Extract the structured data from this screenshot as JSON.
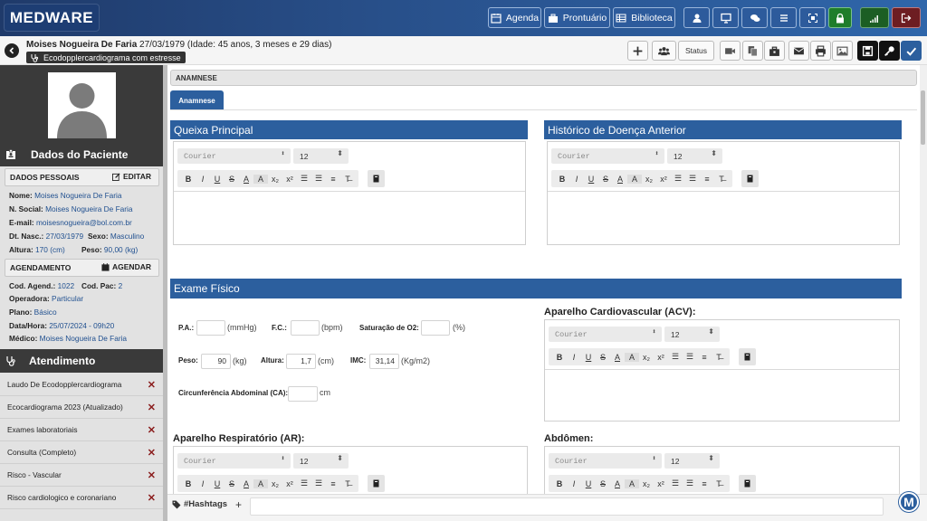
{
  "app": {
    "logo": "MEDWARE"
  },
  "topnav": {
    "agenda": "Agenda",
    "prontuario": "Prontuário",
    "biblioteca": "Biblioteca"
  },
  "patient": {
    "name": "Moises Nogueira De Faria",
    "dob_age": "27/03/1979 (Idade: 45 anos, 3 meses e 29 dias)",
    "exam": "Ecodopplercardiograma com estresse"
  },
  "actions": {
    "status": "Status"
  },
  "sidebar": {
    "title": "Dados do Paciente",
    "personal_header": "DADOS PESSOAIS",
    "edit": "EDITAR",
    "fields": {
      "nome_l": "Nome:",
      "nome": "Moises Nogueira De Faria",
      "nsocial_l": "N. Social:",
      "nsocial": "Moises Nogueira De Faria",
      "email_l": "E-mail:",
      "email": "moisesnogueira@bol.com.br",
      "dtnasc_l": "Dt. Nasc.:",
      "dtnasc": "27/03/1979",
      "sexo_l": "Sexo:",
      "sexo": "Masculino",
      "altura_l": "Altura:",
      "altura": "170 (cm)",
      "peso_l": "Peso:",
      "peso": "90,00 (kg)"
    },
    "sched_header": "AGENDAMENTO",
    "schedule": "AGENDAR",
    "sched": {
      "cod_l": "Cod. Agend.:",
      "cod": "1022",
      "codpac_l": "Cod. Pac:",
      "codpac": "2",
      "oper_l": "Operadora:",
      "oper": "Particular",
      "plano_l": "Plano:",
      "plano": "Básico",
      "data_l": "Data/Hora:",
      "data": "25/07/2024 - 09h20",
      "medico_l": "Médico:",
      "medico": "Moises Nogueira De Faria"
    },
    "atendimento_title": "Atendimento",
    "atendimentos": [
      "Laudo De Ecodopplercardiograma",
      "Ecocardiograma 2023 (Atualizado)",
      "Exames laboratoriais",
      "Consulta (Completo)",
      "Risco - Vascular",
      "Risco cardiologico e coronariano"
    ]
  },
  "main": {
    "anamnese_header": "ANAMNESE",
    "tab": "Anamnese",
    "queixa": "Queixa Principal",
    "historico": "Histórico de Doença Anterior",
    "exame": "Exame Físico",
    "acv": "Aparelho Cardiovascular (ACV):",
    "ar": "Aparelho Respiratório (AR):",
    "abdomen": "Abdômen:",
    "editor": {
      "font": "Courier",
      "size": "12"
    },
    "vitals": {
      "pa_l": "P.A.:",
      "pa_u": "(mmHg)",
      "fc_l": "F.C.:",
      "fc_u": "(bpm)",
      "sat_l": "Saturação de O2:",
      "sat_u": "(%)",
      "peso_l": "Peso:",
      "peso": "90",
      "peso_u": "(kg)",
      "alt_l": "Altura:",
      "alt": "1,7",
      "alt_u": "(cm)",
      "imc_l": "IMC:",
      "imc": "31,14",
      "imc_u": "(Kg/m2)",
      "ca_l": "Circunferência Abdominal (CA):",
      "ca_u": "cm"
    }
  },
  "bottom": {
    "hashtags": "#Hashtags",
    "add": "+",
    "badge": "M"
  }
}
